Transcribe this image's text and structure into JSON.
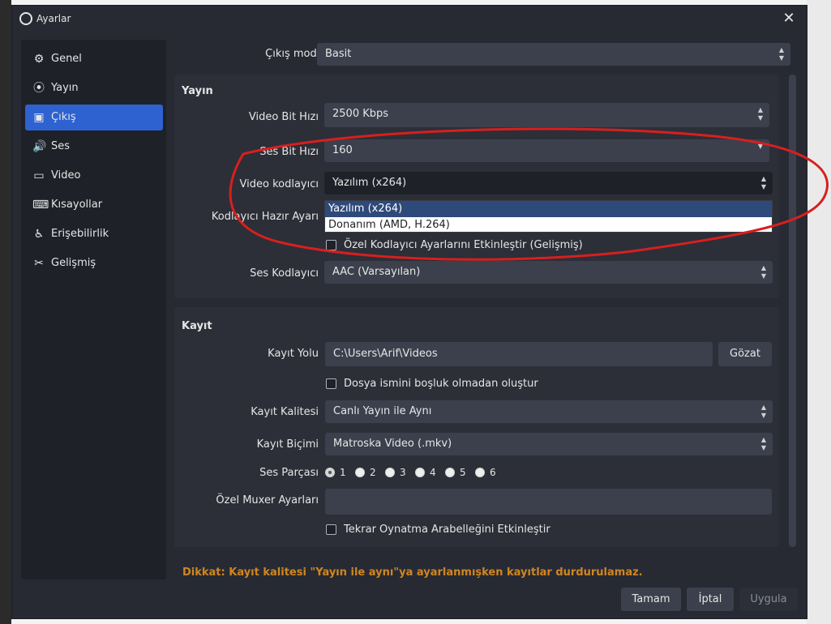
{
  "window": {
    "title": "Ayarlar",
    "close_label": "✕"
  },
  "sidebar": {
    "items": [
      {
        "label": "Genel",
        "icon": "gear-icon",
        "glyph": "⚙"
      },
      {
        "label": "Yayın",
        "icon": "broadcast-icon",
        "glyph": "⦿"
      },
      {
        "label": "Çıkış",
        "icon": "output-icon",
        "glyph": "▣"
      },
      {
        "label": "Ses",
        "icon": "speaker-icon",
        "glyph": "🔊"
      },
      {
        "label": "Video",
        "icon": "monitor-icon",
        "glyph": "▭"
      },
      {
        "label": "Kısayollar",
        "icon": "keyboard-icon",
        "glyph": "⌨"
      },
      {
        "label": "Erişebilirlik",
        "icon": "accessibility-icon",
        "glyph": "♿"
      },
      {
        "label": "Gelişmiş",
        "icon": "tools-icon",
        "glyph": "✂"
      }
    ],
    "active_index": 2
  },
  "output_mode": {
    "label": "Çıkış modu",
    "value": "Basit"
  },
  "streaming": {
    "title": "Yayın",
    "video_bitrate": {
      "label": "Video Bit Hızı",
      "value": "2500 Kbps"
    },
    "audio_bitrate": {
      "label": "Ses Bit Hızı",
      "value": "160"
    },
    "video_encoder": {
      "label": "Video kodlayıcı",
      "value": "Yazılım (x264)",
      "options": [
        "Yazılım (x264)",
        "Donanım (AMD, H.264)"
      ]
    },
    "encoder_preset": {
      "label": "Kodlayıcı Hazır Ayarı"
    },
    "custom_encoder": {
      "label": "Özel Kodlayıcı Ayarlarını Etkinleştir (Gelişmiş)",
      "checked": false
    },
    "audio_encoder": {
      "label": "Ses Kodlayıcı",
      "value": "AAC (Varsayılan)"
    }
  },
  "recording": {
    "title": "Kayıt",
    "path": {
      "label": "Kayıt Yolu",
      "value": "C:\\Users\\Arif\\Videos",
      "browse_label": "Gözat"
    },
    "no_space": {
      "label": "Dosya ismini boşluk olmadan oluştur",
      "checked": false
    },
    "quality": {
      "label": "Kayıt Kalitesi",
      "value": "Canlı Yayın ile Aynı"
    },
    "format": {
      "label": "Kayıt Biçimi",
      "value": "Matroska Video (.mkv)"
    },
    "audio_track": {
      "label": "Ses Parçası",
      "options": [
        "1",
        "2",
        "3",
        "4",
        "5",
        "6"
      ],
      "selected": "1"
    },
    "muxer": {
      "label": "Özel Muxer Ayarları",
      "value": ""
    },
    "replay_buffer": {
      "label": "Tekrar Oynatma Arabelleğini Etkinleştir",
      "checked": false
    }
  },
  "warning": "Dikkat: Kayıt kalitesi \"Yayın ile aynı\"ya ayarlanmışken kayıtlar durdurulamaz.",
  "buttons": {
    "ok": "Tamam",
    "cancel": "İptal",
    "apply": "Uygula"
  },
  "colors": {
    "accent": "#2e62d1",
    "warning": "#d08620",
    "annotation": "#d81f1f"
  }
}
